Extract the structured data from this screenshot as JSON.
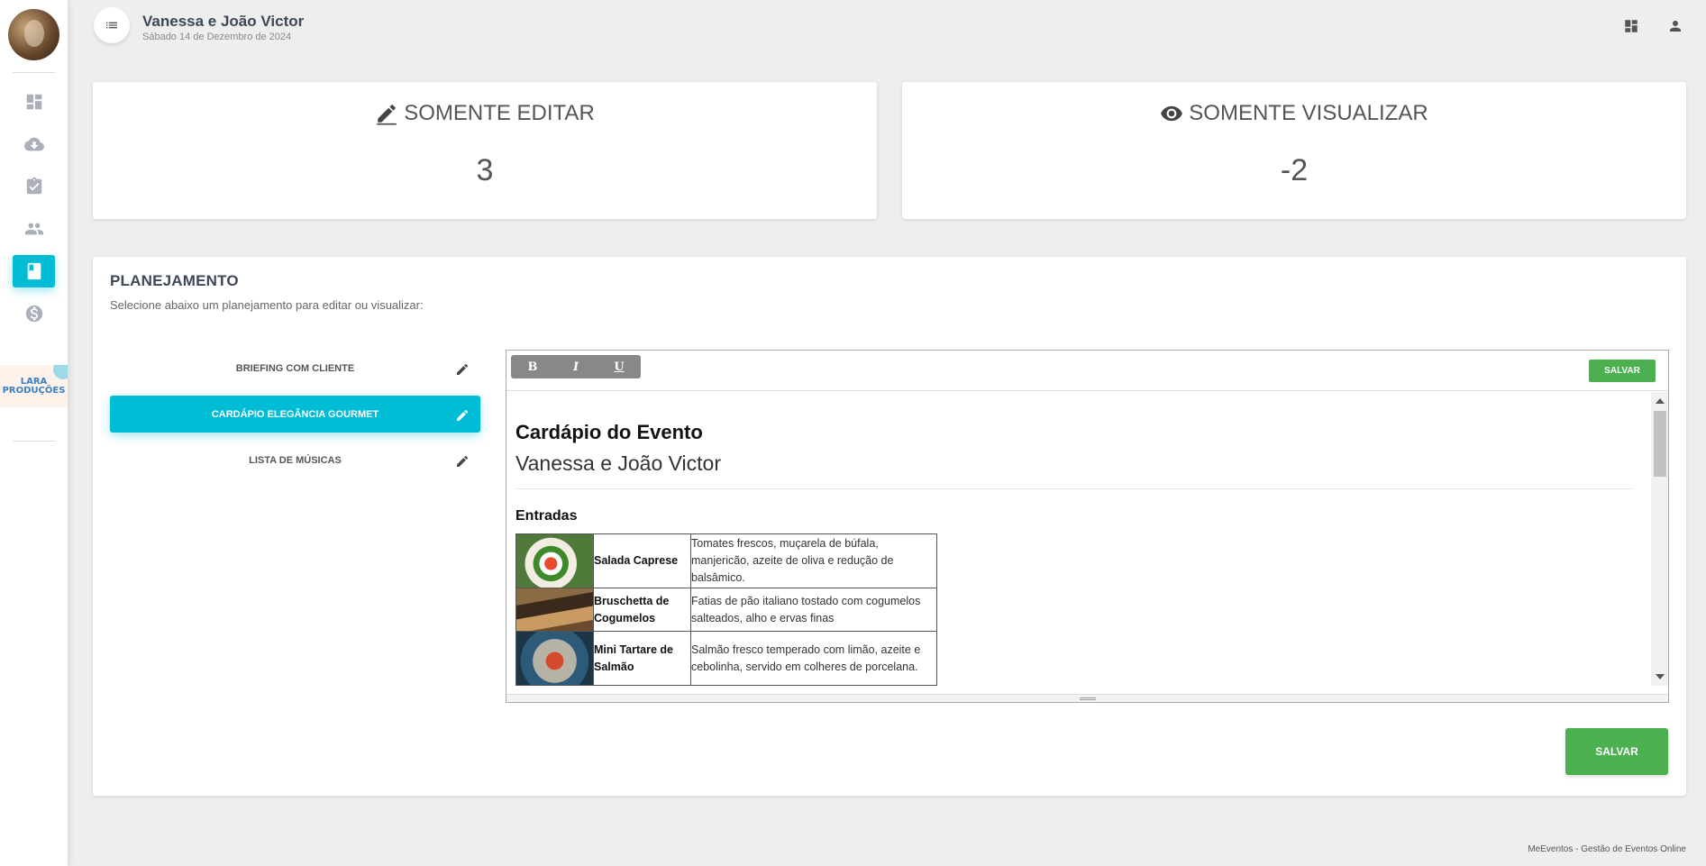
{
  "sidebar": {
    "brand_logo_text": "LARA PRODUÇÕES",
    "items": [
      {
        "name": "dashboard",
        "icon": "dashboard-icon"
      },
      {
        "name": "downloads",
        "icon": "cloud-download-icon"
      },
      {
        "name": "tasks",
        "icon": "assignment-check-icon"
      },
      {
        "name": "guests",
        "icon": "people-icon"
      },
      {
        "name": "planning",
        "icon": "book-icon",
        "active": true
      },
      {
        "name": "finance",
        "icon": "dollar-icon"
      }
    ]
  },
  "header": {
    "title": "Vanessa e João Victor",
    "date": "Sábado 14 de Dezembro de 2024"
  },
  "stats": {
    "edit": {
      "label": "SOMENTE EDITAR",
      "value": "3"
    },
    "view": {
      "label": "SOMENTE VISUALIZAR",
      "value": "-2"
    }
  },
  "planning": {
    "title": "PLANEJAMENTO",
    "subtitle": "Selecione abaixo um planejamento para editar ou visualizar:",
    "items": [
      {
        "label": "BRIEFING COM CLIENTE",
        "active": false
      },
      {
        "label": "CARDÁPIO ELEGÂNCIA GOURMET",
        "active": true
      },
      {
        "label": "LISTA DE MÚSICAS",
        "active": false
      }
    ]
  },
  "editor": {
    "toolbar": {
      "bold": "B",
      "italic": "I",
      "underline": "U",
      "save_label": "SALVAR"
    },
    "document": {
      "heading": "Cardápio do Evento",
      "couple": "Vanessa e João Victor",
      "section": "Entradas",
      "dishes": [
        {
          "name": "Salada Caprese",
          "description": "Tomates frescos, muçarela de búfala, manjericão, azeite de oliva e redução de balsâmico."
        },
        {
          "name": "Bruschetta de Cogumelos",
          "description": "Fatias de pão italiano tostado com cogumelos salteados, alho e ervas finas"
        },
        {
          "name": "Mini Tartare de Salmão",
          "description": "Salmão fresco temperado com limão, azeite e cebolinha, servido em colheres de porcelana."
        }
      ]
    }
  },
  "actions": {
    "save_label": "SALVAR"
  },
  "footer": {
    "text": "MeEventos - Gestão de Eventos Online"
  },
  "colors": {
    "accent": "#00bcd4",
    "save": "#4caf50",
    "background": "#eeeeee"
  }
}
